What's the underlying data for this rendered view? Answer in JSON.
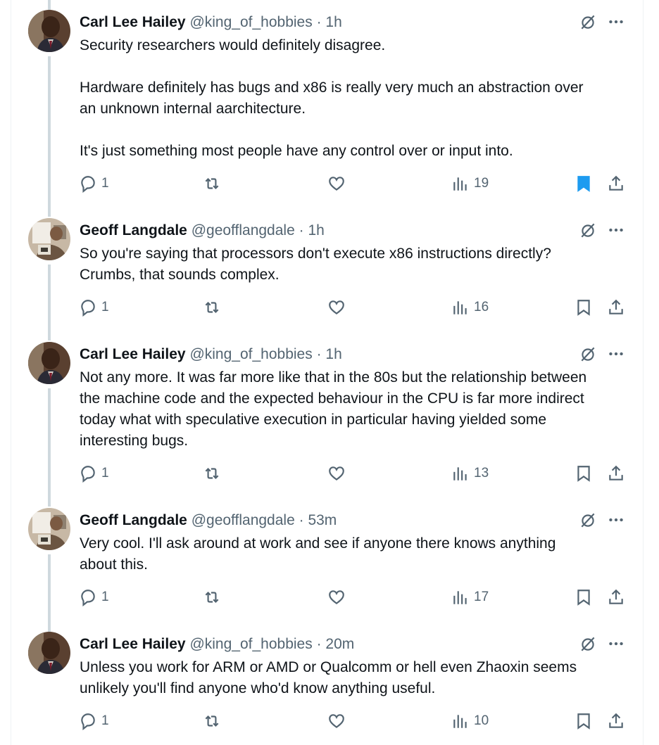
{
  "tweets": [
    {
      "name": "Carl Lee Hailey",
      "handle": "@king_of_hobbies",
      "sep": "·",
      "time": "1h",
      "text": "Security researchers would definitely disagree.\n\nHardware definitely has bugs and x86 is really very much an abstraction over\nan unknown internal aarchitecture.\n\nIt's just something most people have any control over or input into.",
      "replies": "1",
      "views": "19",
      "bookmarked": true
    },
    {
      "name": "Geoff Langdale",
      "handle": "@geofflangdale",
      "sep": "·",
      "time": "1h",
      "text": "So you're saying that processors don't execute x86 instructions directly?\nCrumbs, that sounds complex.",
      "replies": "1",
      "views": "16",
      "bookmarked": false
    },
    {
      "name": "Carl Lee Hailey",
      "handle": "@king_of_hobbies",
      "sep": "·",
      "time": "1h",
      "text": "Not any more. It was far more like that in the 80s but the relationship between\nthe machine code and the expected behaviour in the CPU is far more indirect\ntoday what with speculative execution in particular having yielded some\ninteresting bugs.",
      "replies": "1",
      "views": "13",
      "bookmarked": false
    },
    {
      "name": "Geoff Langdale",
      "handle": "@geofflangdale",
      "sep": "·",
      "time": "53m",
      "text": "Very cool. I'll ask around at work and see if anyone there knows anything\nabout this.",
      "replies": "1",
      "views": "17",
      "bookmarked": false
    },
    {
      "name": "Carl Lee Hailey",
      "handle": "@king_of_hobbies",
      "sep": "·",
      "time": "20m",
      "text": "Unless you work for ARM or AMD or Qualcomm or hell even Zhaoxin seems\nunlikely you'll find anyone who'd know anything useful.",
      "replies": "1",
      "views": "10",
      "bookmarked": false
    }
  ],
  "colors": {
    "text": "#0f1419",
    "secondary": "#536471",
    "accent": "#1d9bf0",
    "thread_line": "#cfd9de"
  },
  "icons": {
    "reply": "reply-icon",
    "repost": "repost-icon",
    "like": "like-icon",
    "views": "views-icon",
    "bookmark": "bookmark-icon",
    "share": "share-icon",
    "grok": "grok-icon",
    "more": "more-icon"
  }
}
